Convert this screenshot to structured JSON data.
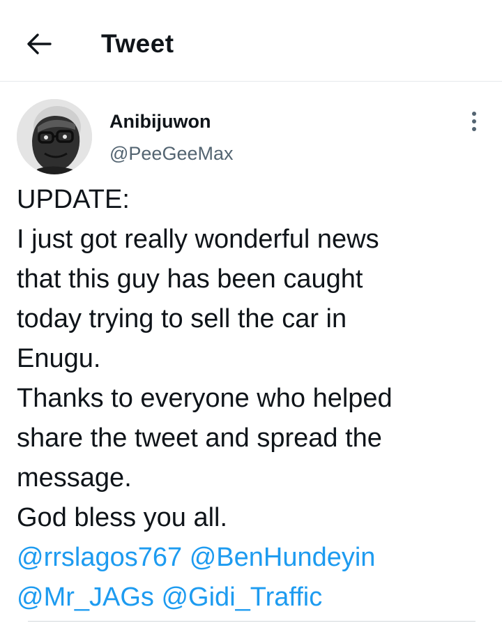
{
  "header": {
    "title": "Tweet",
    "back_icon": "arrow-left-icon"
  },
  "author": {
    "display_name": "Anibijuwon",
    "handle": "@PeeGeeMax",
    "avatar_icon": "profile-photo"
  },
  "more_icon": "more-vertical-icon",
  "tweet": {
    "lines": [
      "UPDATE:",
      "I just got really wonderful news",
      "that this guy has been caught",
      "today trying to sell the car in",
      "Enugu.",
      "Thanks to everyone who helped",
      "share the tweet and spread the",
      "message.",
      "God bless you all."
    ],
    "mentions": [
      "@rrslagos767",
      "@BenHundeyin",
      "@Mr_JAGs",
      "@Gidi_Traffic"
    ]
  },
  "colors": {
    "accent": "#1d9bf0",
    "text": "#0f1419",
    "muted": "#536471"
  }
}
